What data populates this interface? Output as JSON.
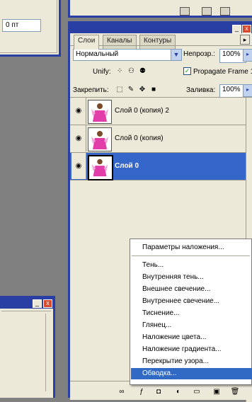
{
  "top_left_panel": {
    "field_value": "0 пт"
  },
  "layers_panel": {
    "tabs": [
      {
        "label": "Слои"
      },
      {
        "label": "Каналы"
      },
      {
        "label": "Контуры"
      }
    ],
    "blend_mode": "Нормальный",
    "opacity_label": "Непрозр.:",
    "opacity_value": "100%",
    "unify_label": "Unify:",
    "propagate_label": "Propagate Frame 1",
    "propagate_checked": "✓",
    "lock_label": "Закрепить:",
    "fill_label": "Заливка:",
    "fill_value": "100%",
    "layers": [
      {
        "name": "Слой 0 (копия) 2",
        "selected": false
      },
      {
        "name": "Слой 0 (копия)",
        "selected": false
      },
      {
        "name": "Слой 0",
        "selected": true
      }
    ]
  },
  "context_menu": {
    "top": "Параметры наложения...",
    "items": [
      "Тень...",
      "Внутренняя тень...",
      "Внешнее свечение...",
      "Внутреннее свечение...",
      "Тиснение...",
      "Глянец...",
      "Наложение цвета...",
      "Наложение градиента...",
      "Перекрытие узора...",
      "Обводка..."
    ],
    "highlighted_index": 9
  },
  "colors": {
    "frame_blue": "#2a3fa3",
    "selection_blue": "#3566c9",
    "menu_highlight": "#316ac5",
    "panel_bg": "#ece9d8"
  }
}
